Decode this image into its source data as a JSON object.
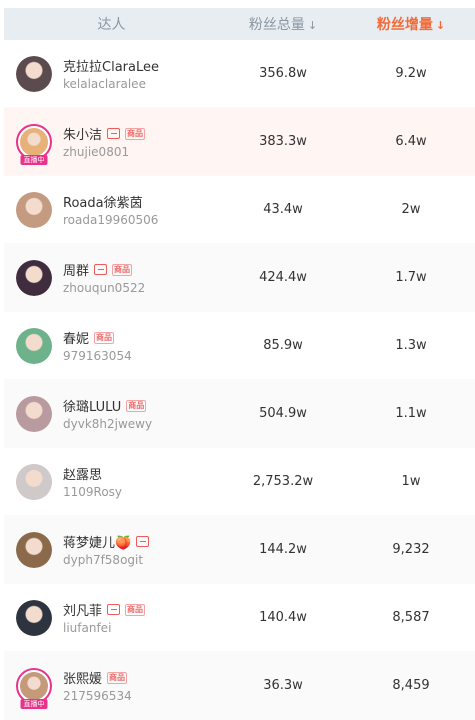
{
  "header": {
    "talent": "达人",
    "fans_total": "粉丝总量",
    "fans_increase": "粉丝增量",
    "sort_arrow": "↓",
    "active_color": "#f26b3a"
  },
  "rows": [
    {
      "name": "克拉拉ClaraLee",
      "handle": "kelalaclaralee",
      "total": "356.8w",
      "incr": "9.2w",
      "live": false,
      "icons": [],
      "avatar_color": "#5b4a4e"
    },
    {
      "name": "朱小洁",
      "handle": "zhujie0801",
      "total": "383.3w",
      "incr": "6.4w",
      "live": true,
      "live_label": "直播中",
      "icons": [
        "tv-icon",
        "shop-icon"
      ],
      "avatar_color": "#e6b27a"
    },
    {
      "name": "Roada徐紫茵",
      "handle": "roada19960506",
      "total": "43.4w",
      "incr": "2w",
      "live": false,
      "icons": [],
      "avatar_color": "#c49a80"
    },
    {
      "name": "周群",
      "handle": "zhouqun0522",
      "total": "424.4w",
      "incr": "1.7w",
      "live": false,
      "icons": [
        "tv-icon",
        "shop-icon"
      ],
      "avatar_color": "#3f2d3f"
    },
    {
      "name": "春妮",
      "handle": "979163054",
      "total": "85.9w",
      "incr": "1.3w",
      "live": false,
      "icons": [
        "shop-icon"
      ],
      "avatar_color": "#6db28a"
    },
    {
      "name": "徐璐LULU",
      "handle": "dyvk8h2jwewy",
      "total": "504.9w",
      "incr": "1.1w",
      "live": false,
      "icons": [
        "shop-icon"
      ],
      "avatar_color": "#b99a9e"
    },
    {
      "name": "赵露思",
      "handle": "1109Rosy",
      "total": "2,753.2w",
      "incr": "1w",
      "live": false,
      "icons": [],
      "avatar_color": "#cfc9c9"
    },
    {
      "name": "蒋梦婕儿🍑",
      "handle": "dyph7f58ogit",
      "total": "144.2w",
      "incr": "9,232",
      "live": false,
      "icons": [
        "tv-icon"
      ],
      "avatar_color": "#8a6a4a"
    },
    {
      "name": "刘凡菲",
      "handle": "liufanfei",
      "total": "140.4w",
      "incr": "8,587",
      "live": false,
      "icons": [
        "tv-icon",
        "shop-icon"
      ],
      "avatar_color": "#2d3440"
    },
    {
      "name": "张熙媛",
      "handle": "217596534",
      "total": "36.3w",
      "incr": "8,459",
      "live": true,
      "live_label": "直播中",
      "icons": [
        "shop-icon"
      ],
      "avatar_color": "#c49a7a"
    }
  ],
  "icon_text": {
    "shop": "商品"
  }
}
